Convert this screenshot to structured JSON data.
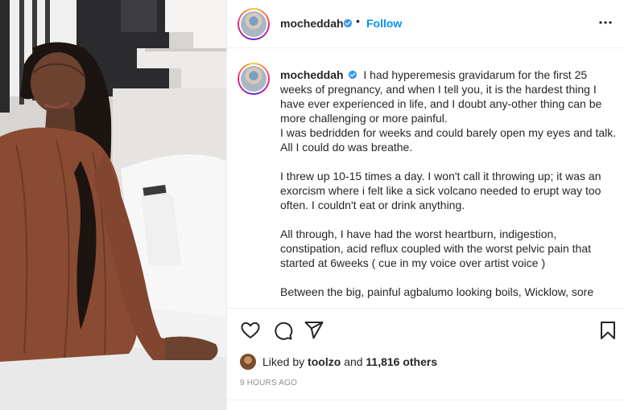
{
  "post": {
    "username": "mocheddah",
    "follow_label": "Follow",
    "separator": "•",
    "caption_paragraphs": [
      [
        "I had hyperemesis gravidarum for the first 25 weeks of pregnancy, and when I tell you, it is the hardest thing I have ever experienced in life, and I doubt any-other thing can be more challenging or more painful.",
        "I was bedridden for weeks and could barely open my eyes and talk. All I could do was breathe."
      ],
      [
        "I threw up 10-15 times a day. I won't call it throwing up; it was an exorcism where i felt like a sick volcano needed to erupt way too often. I couldn't eat or drink anything."
      ],
      [
        "All through, I have had the worst heartburn, indigestion, constipation, acid reflux coupled with the worst pelvic pain that started at 6weeks ( cue in my voice over artist voice )"
      ],
      [
        "Between the big, painful agbalumo looking boils, Wicklow, sore"
      ]
    ],
    "liked_by_prefix": "Liked by",
    "liked_by_user": "toolzo",
    "liked_by_and": "and",
    "liked_by_others": "11,816 others",
    "timestamp": "9 HOURS AGO"
  },
  "icons": {
    "verified": "verified-badge-icon",
    "more": "more-options-icon",
    "like": "heart-icon",
    "comment": "comment-icon",
    "share": "share-icon",
    "save": "bookmark-icon"
  },
  "colors": {
    "accent": "#0095f6",
    "verified": "#3897f0",
    "text": "#262626",
    "muted": "#8e8e8e"
  }
}
